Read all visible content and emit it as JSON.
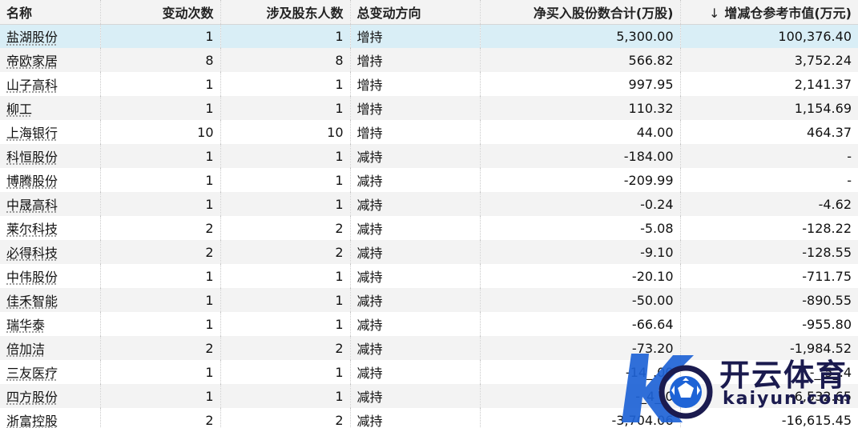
{
  "table": {
    "columns": [
      "名称",
      "变动次数",
      "涉及股东人数",
      "总变动方向",
      "净买入股份数合计(万股)",
      "增减仓参考市值(万元)"
    ],
    "sort_indicator": "↓",
    "rows": [
      {
        "name": "盐湖股份",
        "count": "1",
        "holders": "1",
        "direction": "增持",
        "net_shares": "5,300.00",
        "value": "100,376.40"
      },
      {
        "name": "帝欧家居",
        "count": "8",
        "holders": "8",
        "direction": "增持",
        "net_shares": "566.82",
        "value": "3,752.24"
      },
      {
        "name": "山子高科",
        "count": "1",
        "holders": "1",
        "direction": "增持",
        "net_shares": "997.95",
        "value": "2,141.37"
      },
      {
        "name": "柳工",
        "count": "1",
        "holders": "1",
        "direction": "增持",
        "net_shares": "110.32",
        "value": "1,154.69"
      },
      {
        "name": "上海银行",
        "count": "10",
        "holders": "10",
        "direction": "增持",
        "net_shares": "44.00",
        "value": "464.37"
      },
      {
        "name": "科恒股份",
        "count": "1",
        "holders": "1",
        "direction": "减持",
        "net_shares": "-184.00",
        "value": "-"
      },
      {
        "name": "博腾股份",
        "count": "1",
        "holders": "1",
        "direction": "减持",
        "net_shares": "-209.99",
        "value": "-"
      },
      {
        "name": "中晟高科",
        "count": "1",
        "holders": "1",
        "direction": "减持",
        "net_shares": "-0.24",
        "value": "-4.62"
      },
      {
        "name": "莱尔科技",
        "count": "2",
        "holders": "2",
        "direction": "减持",
        "net_shares": "-5.08",
        "value": "-128.22"
      },
      {
        "name": "必得科技",
        "count": "2",
        "holders": "2",
        "direction": "减持",
        "net_shares": "-9.10",
        "value": "-128.55"
      },
      {
        "name": "中伟股份",
        "count": "1",
        "holders": "1",
        "direction": "减持",
        "net_shares": "-20.10",
        "value": "-711.75"
      },
      {
        "name": "佳禾智能",
        "count": "1",
        "holders": "1",
        "direction": "减持",
        "net_shares": "-50.00",
        "value": "-890.55"
      },
      {
        "name": "瑞华泰",
        "count": "1",
        "holders": "1",
        "direction": "减持",
        "net_shares": "-66.64",
        "value": "-955.80"
      },
      {
        "name": "倍加洁",
        "count": "2",
        "holders": "2",
        "direction": "减持",
        "net_shares": "-73.20",
        "value": "-1,984.52"
      },
      {
        "name": "三友医疗",
        "count": "1",
        "holders": "1",
        "direction": "减持",
        "net_shares": "-14_.00",
        "value": "-_,5_.4"
      },
      {
        "name": "四方股份",
        "count": "1",
        "holders": "1",
        "direction": "减持",
        "net_shares": "-_4_.0",
        "value": "-6,532.65"
      },
      {
        "name": "浙富控股",
        "count": "2",
        "holders": "2",
        "direction": "减持",
        "net_shares": "-3,704.06",
        "value": "-16,615.45"
      }
    ]
  },
  "watermark": {
    "text_cn": "开云体育",
    "text_en": "kaiyun.com",
    "colors": {
      "blue": "#1e63d6",
      "ring": "#1b1b4f"
    }
  },
  "colors": {
    "selected_row": "#d9eef6",
    "stripe": "#f3f3f3"
  }
}
